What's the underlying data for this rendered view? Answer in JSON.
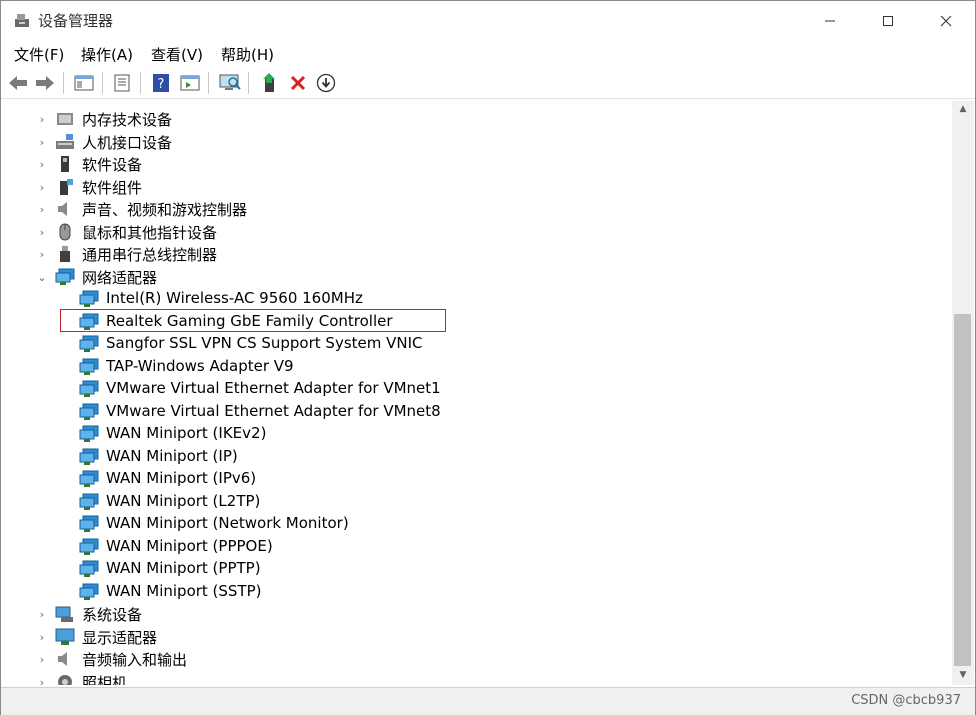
{
  "window": {
    "title": "设备管理器"
  },
  "menu": [
    {
      "label": "文件(F)"
    },
    {
      "label": "操作(A)"
    },
    {
      "label": "查看(V)"
    },
    {
      "label": "帮助(H)"
    }
  ],
  "tree": {
    "categories_top": [
      {
        "label": "内存技术设备",
        "icon": "memory-icon"
      },
      {
        "label": "人机接口设备",
        "icon": "hid-icon"
      },
      {
        "label": "软件设备",
        "icon": "software-device-icon"
      },
      {
        "label": "软件组件",
        "icon": "software-component-icon"
      },
      {
        "label": "声音、视频和游戏控制器",
        "icon": "speaker-icon"
      },
      {
        "label": "鼠标和其他指针设备",
        "icon": "mouse-icon"
      },
      {
        "label": "通用串行总线控制器",
        "icon": "usb-icon"
      }
    ],
    "network": {
      "label": "网络适配器",
      "icon": "network-icon",
      "adapters": [
        "Intel(R) Wireless-AC 9560 160MHz",
        "Realtek Gaming GbE Family Controller",
        "Sangfor SSL VPN CS Support System VNIC",
        "TAP-Windows Adapter V9",
        "VMware Virtual Ethernet Adapter for VMnet1",
        "VMware Virtual Ethernet Adapter for VMnet8",
        "WAN Miniport (IKEv2)",
        "WAN Miniport (IP)",
        "WAN Miniport (IPv6)",
        "WAN Miniport (L2TP)",
        "WAN Miniport (Network Monitor)",
        "WAN Miniport (PPPOE)",
        "WAN Miniport (PPTP)",
        "WAN Miniport (SSTP)"
      ],
      "highlighted": "Realtek Gaming GbE Family Controller"
    },
    "categories_bottom": [
      {
        "label": "系统设备",
        "icon": "system-device-icon"
      },
      {
        "label": "显示适配器",
        "icon": "display-adapter-icon"
      },
      {
        "label": "音频输入和输出",
        "icon": "audio-io-icon"
      },
      {
        "label": "照相机",
        "icon": "camera-icon"
      }
    ]
  },
  "statusbar": {
    "watermark": "CSDN @cbcb937"
  },
  "colors": {
    "highlight_border": "#c8232c",
    "network_icon": "#2b8fd6"
  }
}
